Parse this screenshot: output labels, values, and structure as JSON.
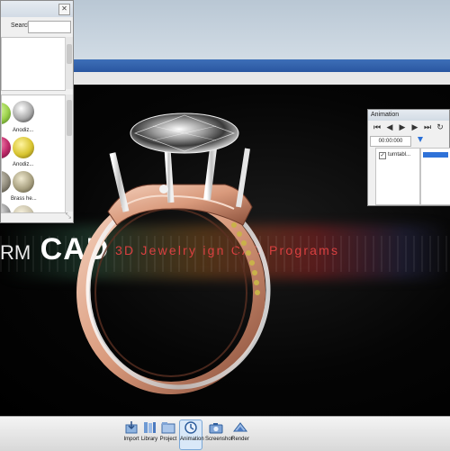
{
  "material_panel": {
    "search_label": "Search:",
    "search_value": "",
    "swatches": [
      {
        "label": "",
        "color": "#9ad04a"
      },
      {
        "label": "",
        "color": "#d9d9d9"
      },
      {
        "label": "Anodiz...",
        "color": "#c02a6a"
      },
      {
        "label": "Anodiz...",
        "color": "#d8c430"
      },
      {
        "label": "",
        "color": "#8f8a7a"
      },
      {
        "label": "Anodiz...",
        "color": "#a8a080"
      },
      {
        "label": "Brass he...",
        "color": "#c9c2aa"
      }
    ]
  },
  "viewport": {
    "brand_prefix": "RM",
    "brand_name": "CAD",
    "tagline": "3D Jewelry   ign CAD Programs"
  },
  "animation": {
    "title": "Animation",
    "time": "00:00:000",
    "item_label": "turntabl...",
    "item_checked": true
  },
  "toolbar": {
    "items": [
      {
        "label": "Import",
        "icon": "import-icon"
      },
      {
        "label": "Library",
        "icon": "library-icon"
      },
      {
        "label": "Project",
        "icon": "project-icon"
      },
      {
        "label": "Animation",
        "icon": "animation-icon",
        "active": true
      },
      {
        "label": "Screenshot",
        "icon": "screenshot-icon"
      },
      {
        "label": "Render",
        "icon": "render-icon"
      }
    ]
  },
  "colors": {
    "tagline": "#d94040",
    "accent": "#2f72d8",
    "rose_gold": "#e8b49a",
    "white_gold": "#d8d8d8"
  }
}
